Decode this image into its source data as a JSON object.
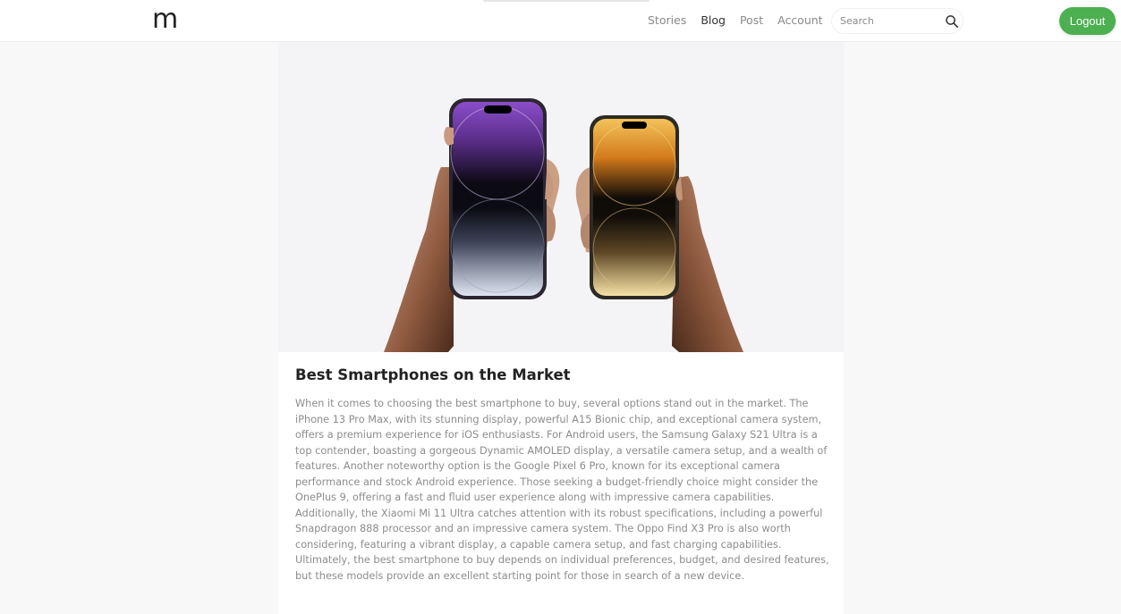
{
  "nav": {
    "logo": "m",
    "links": [
      "Stories",
      "Blog",
      "Post",
      "Account"
    ],
    "active_link": "Blog",
    "search_placeholder": "Search",
    "logout_label": "Logout"
  },
  "colors": {
    "accent": "#4caf50",
    "title": "#222222",
    "body_text": "#8c8c8c"
  },
  "post": {
    "image": "two-iphones-held-in-hands",
    "title": "Best Smartphones on the Market",
    "body": "When it comes to choosing the best smartphone to buy, several options stand out in the market. The iPhone 13 Pro Max, with its stunning display, powerful A15 Bionic chip, and exceptional camera system, offers a premium experience for iOS enthusiasts. For Android users, the Samsung Galaxy S21 Ultra is a top contender, boasting a gorgeous Dynamic AMOLED display, a versatile camera setup, and a wealth of features. Another noteworthy option is the Google Pixel 6 Pro, known for its exceptional camera performance and stock Android experience. Those seeking a budget-friendly choice might consider the OnePlus 9, offering a fast and fluid user experience along with impressive camera capabilities. Additionally, the Xiaomi Mi 11 Ultra catches attention with its robust specifications, including a powerful Snapdragon 888 processor and an impressive camera system. The Oppo Find X3 Pro is also worth considering, featuring a vibrant display, a capable camera setup, and fast charging capabilities. Ultimately, the best smartphone to buy depends on individual preferences, budget, and desired features, but these models provide an excellent starting point for those in search of a new device."
  }
}
